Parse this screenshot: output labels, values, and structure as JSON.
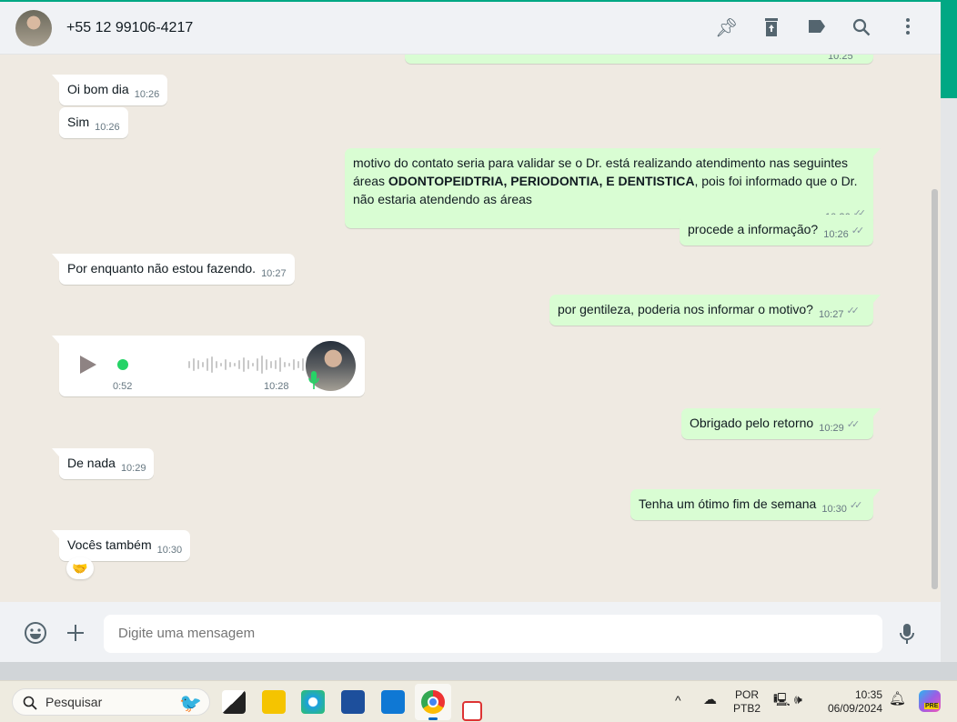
{
  "header": {
    "contact": "+55 12 99106-4217",
    "icons": [
      "pin-icon",
      "delete-icon",
      "label-icon",
      "search-icon",
      "menu-icon"
    ]
  },
  "messages": [
    {
      "dir": "out",
      "text": "",
      "time": "10:25"
    },
    {
      "dir": "in",
      "text": "Oi bom dia",
      "time": "10:26"
    },
    {
      "dir": "in",
      "text": "Sim",
      "time": "10:26"
    },
    {
      "dir": "out",
      "text_pre": "motivo do contato seria para validar se o Dr. está realizando atendimento nas seguintes áreas ",
      "text_bold": "ODONTOPEIDTRIA, PERIODONTIA, E DENTISTICA",
      "text_post": ", pois foi informado que o Dr. não estaria atendendo as áreas",
      "time": "10:26"
    },
    {
      "dir": "out",
      "text": "procede a informação?",
      "time": "10:26"
    },
    {
      "dir": "in",
      "text": "Por enquanto não estou fazendo.",
      "time": "10:27"
    },
    {
      "dir": "out",
      "text": "por gentileza, poderia nos informar o motivo?",
      "time": "10:27"
    },
    {
      "dir": "in",
      "type": "voice",
      "duration": "0:52",
      "time": "10:28"
    },
    {
      "dir": "out",
      "text": "Obrigado pelo retorno",
      "time": "10:29"
    },
    {
      "dir": "in",
      "text": "De nada",
      "time": "10:29"
    },
    {
      "dir": "out",
      "text": "Tenha um ótimo fim de semana",
      "time": "10:30"
    },
    {
      "dir": "in",
      "text": "Vocês também",
      "time": "10:30",
      "reaction": "🤝"
    }
  ],
  "footer": {
    "placeholder": "Digite uma mensagem"
  },
  "taskbar": {
    "search": "Pesquisar",
    "lang1": "POR",
    "lang2": "PTB2",
    "clock": "10:35",
    "date": "06/09/2024",
    "copilot_badge": "PRE"
  }
}
